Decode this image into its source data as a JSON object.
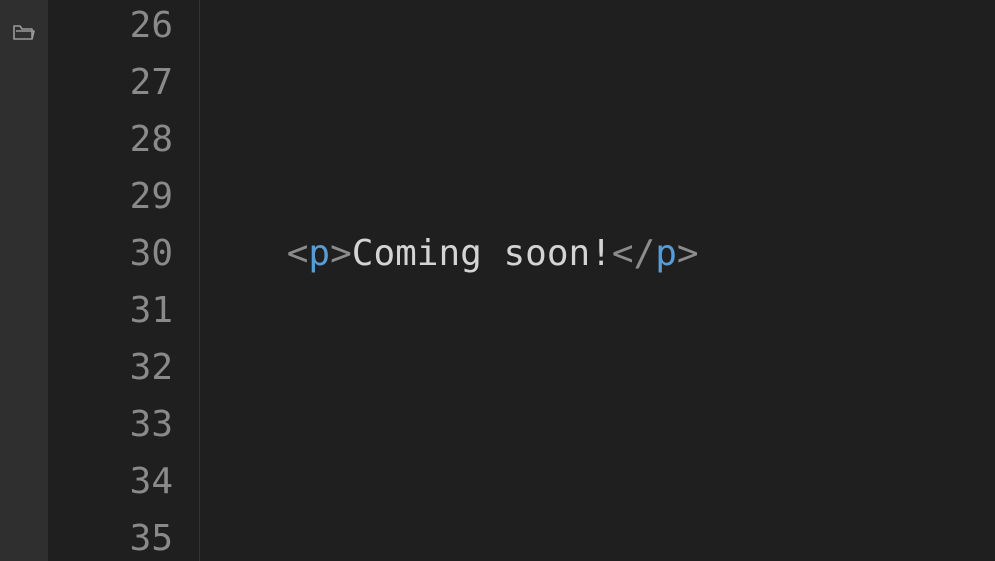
{
  "activity_bar": {
    "explorer_icon": "folder-icon"
  },
  "editor": {
    "line_numbers": [
      "26",
      "27",
      "28",
      "29",
      "30",
      "31",
      "32",
      "33",
      "34",
      "35"
    ],
    "code_line_30": {
      "indent": "  ",
      "open_lt": "<",
      "open_tag": "p",
      "open_gt": ">",
      "text": "Coming soon!",
      "close_lt": "</",
      "close_tag": "p",
      "close_gt": ">"
    }
  },
  "colors": {
    "background": "#1f1f1f",
    "activity_bar": "#2f2f2f",
    "line_number": "#8a8a8a",
    "tag": "#569cd6",
    "bracket": "#8c8c8c",
    "text": "#d4d4d4"
  }
}
